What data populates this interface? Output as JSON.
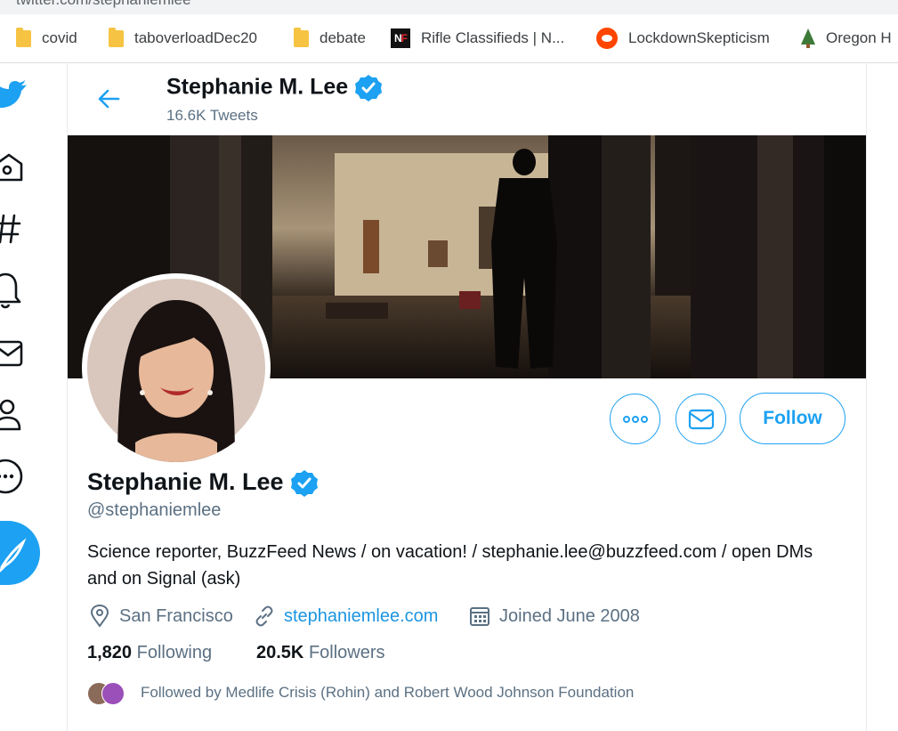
{
  "browser": {
    "url": "twitter.com/stephaniemlee",
    "bookmarks": [
      {
        "label": "covid",
        "icon": "folder-icon"
      },
      {
        "label": "taboverloadDec20",
        "icon": "folder-icon"
      },
      {
        "label": "debate",
        "icon": "folder-icon"
      },
      {
        "label": "Rifle Classifieds | N...",
        "icon": "nf-logo-icon"
      },
      {
        "label": "LockdownSkepticism",
        "icon": "reddit-icon"
      },
      {
        "label": "Oregon H",
        "icon": "tree-icon"
      }
    ]
  },
  "nav": {
    "icons": [
      "twitter-bird-icon",
      "home-icon",
      "explore-hashtag-icon",
      "notifications-bell-icon",
      "messages-envelope-icon",
      "profile-person-icon",
      "more-icon"
    ],
    "compose_icon": "compose-feather-icon"
  },
  "header": {
    "name": "Stephanie M. Lee",
    "tweet_count": "16.6K Tweets"
  },
  "profile": {
    "name": "Stephanie M. Lee",
    "handle": "@stephaniemlee",
    "bio": "Science reporter, BuzzFeed News / on vacation! / stephanie.lee@buzzfeed.com / open DMs and on Signal (ask)",
    "location": "San Francisco",
    "website": "stephaniemlee.com",
    "joined": "Joined June 2008",
    "following_count": "1,820",
    "following_label": "Following",
    "followers_count": "20.5K",
    "followers_label": "Followers",
    "followed_by": "Followed by Medlife Crisis (Rohin) and Robert Wood Johnson Foundation",
    "verified": true
  },
  "actions": {
    "follow_label": "Follow",
    "more_icon": "more-dots-icon",
    "message_icon": "envelope-icon"
  },
  "colors": {
    "accent": "#1da1f2",
    "link": "#1b95e0",
    "secondary_text": "#5b7083",
    "primary_text": "#0f1419"
  }
}
